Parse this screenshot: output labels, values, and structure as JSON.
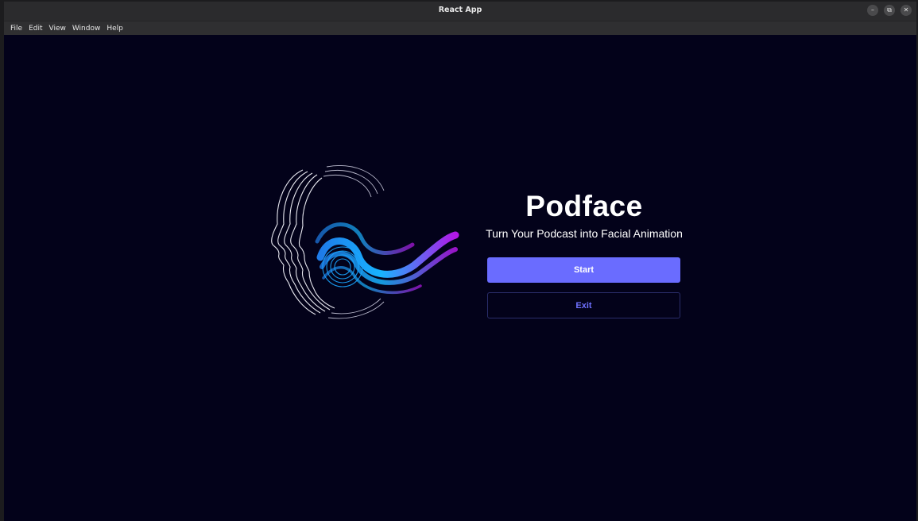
{
  "window": {
    "title": "React App",
    "controls": {
      "minimize": "–",
      "restore": "⧉",
      "close": "✕"
    }
  },
  "menubar": {
    "items": [
      "File",
      "Edit",
      "View",
      "Window",
      "Help"
    ]
  },
  "app": {
    "name": "Podface",
    "tagline": "Turn Your Podcast into Facial Animation",
    "start_label": "Start",
    "exit_label": "Exit",
    "logo_icon": "face-soundwave-logo-icon",
    "colors": {
      "background": "#03021a",
      "primary": "#6a6cff",
      "exit_text": "#6f71ff",
      "logo_cyan": "#18b4ff",
      "logo_purple": "#b317e6"
    }
  }
}
